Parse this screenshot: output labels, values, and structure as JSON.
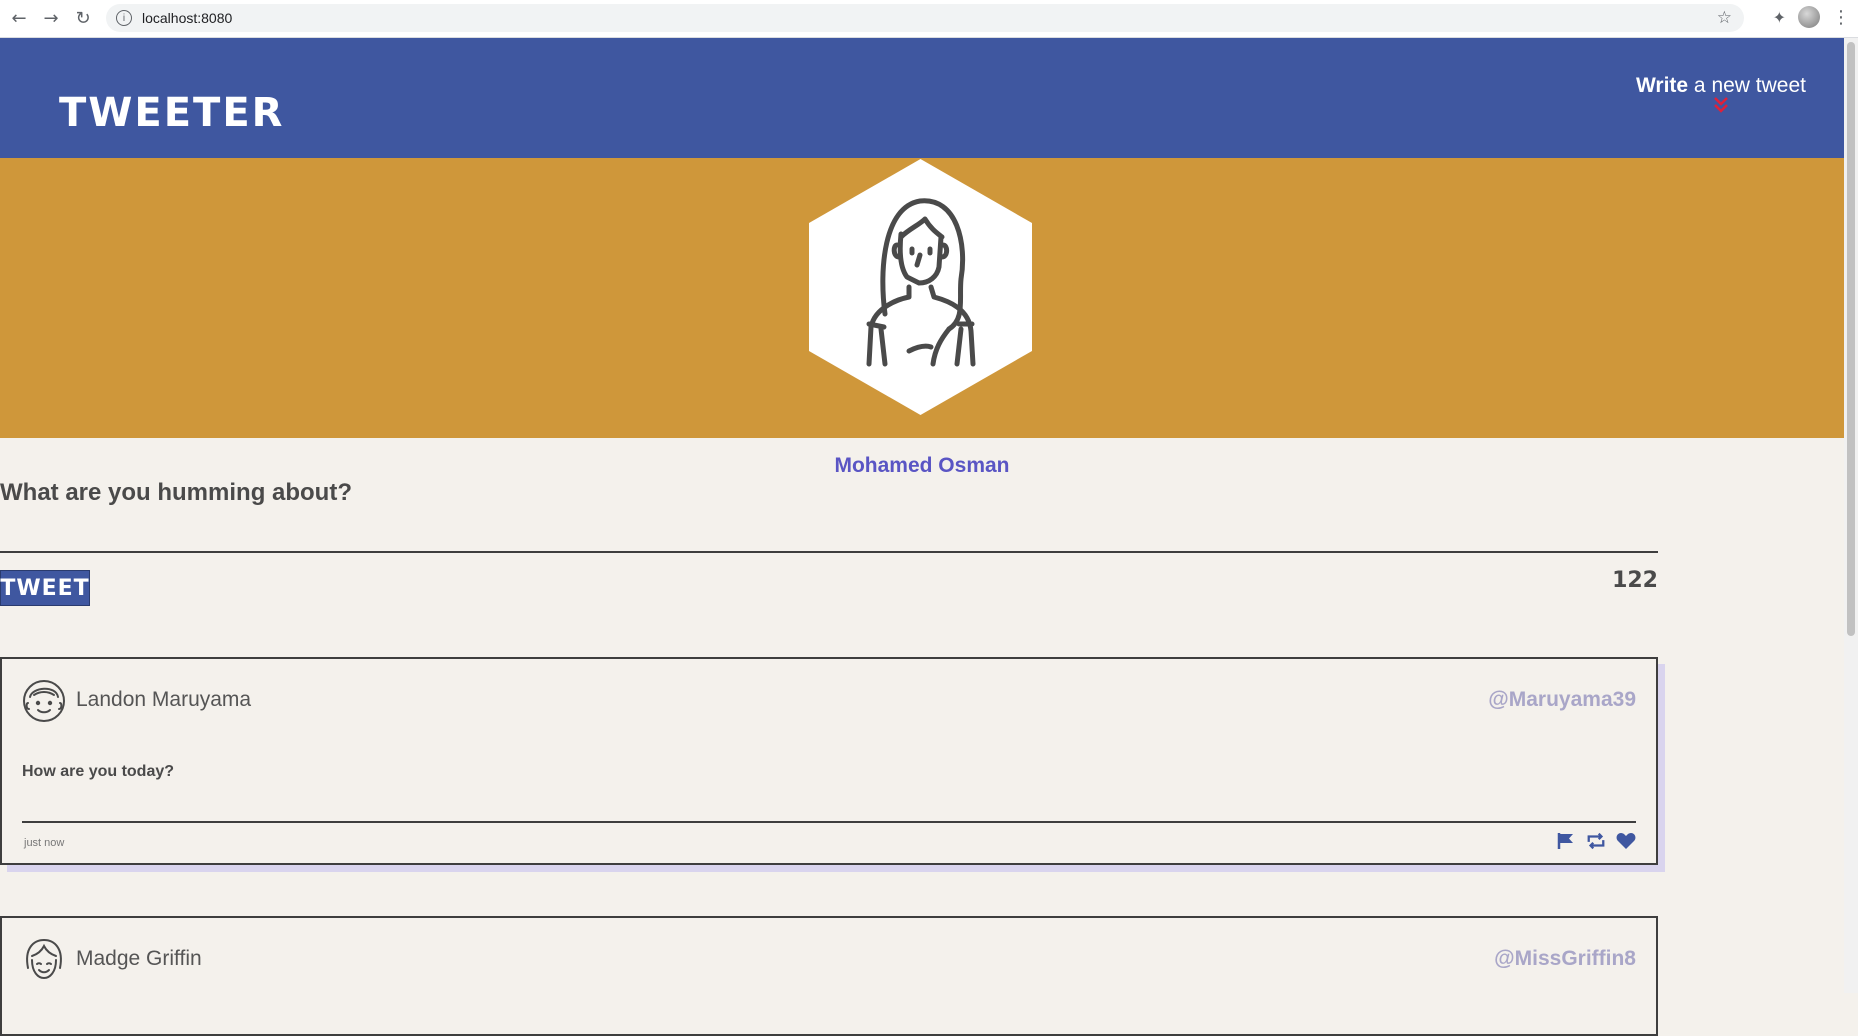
{
  "browser": {
    "url": "localhost:8080",
    "icons": [
      "back-icon",
      "forward-icon",
      "reload-icon",
      "info-icon",
      "star-icon",
      "extensions-icon",
      "profile-avatar",
      "menu-icon"
    ]
  },
  "nav": {
    "brand": "TWEETER",
    "compose_bold": "Write",
    "compose_rest": " a new tweet",
    "chevron": "»"
  },
  "profile": {
    "name": "Mohamed Osman",
    "band_color": "#cf973a"
  },
  "composer": {
    "question": "What are you humming about?",
    "button_label": "TWEET",
    "counter": "122"
  },
  "tweets": [
    {
      "name": "Landon Maruyama",
      "handle": "@Maruyama39",
      "body": "How are you today?",
      "time": "just now",
      "actions": [
        "flag-icon",
        "retweet-icon",
        "heart-icon"
      ]
    },
    {
      "name": "Madge Griffin",
      "handle": "@MissGriffin8"
    }
  ],
  "colors": {
    "nav": "#3f57a0",
    "accent_name": "#5a55c4",
    "handle": "#a9a6c8",
    "action_icon": "#3f57a0"
  }
}
